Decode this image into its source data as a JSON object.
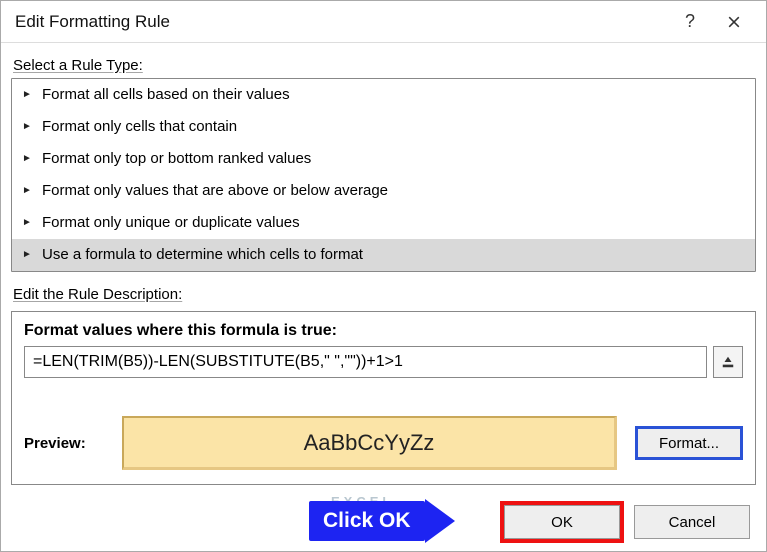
{
  "dialog": {
    "title": "Edit Formatting Rule"
  },
  "ruleTypeLabel": "Select a Rule Type:",
  "ruleList": [
    {
      "label": "Format all cells based on their values",
      "selected": false
    },
    {
      "label": "Format only cells that contain",
      "selected": false
    },
    {
      "label": "Format only top or bottom ranked values",
      "selected": false
    },
    {
      "label": "Format only values that are above or below average",
      "selected": false
    },
    {
      "label": "Format only unique or duplicate values",
      "selected": false
    },
    {
      "label": "Use a formula to determine which cells to format",
      "selected": true
    }
  ],
  "editDescLabel": "Edit the Rule Description:",
  "formulaLabel": "Format values where this formula is true:",
  "formulaValue": "=LEN(TRIM(B5))-LEN(SUBSTITUTE(B5,\" \",\"\"))+1>1",
  "previewLabel": "Preview:",
  "previewText": "AaBbCcYyZz",
  "formatBtn": "Format...",
  "okBtn": "OK",
  "cancelBtn": "Cancel",
  "callout": "Click OK"
}
